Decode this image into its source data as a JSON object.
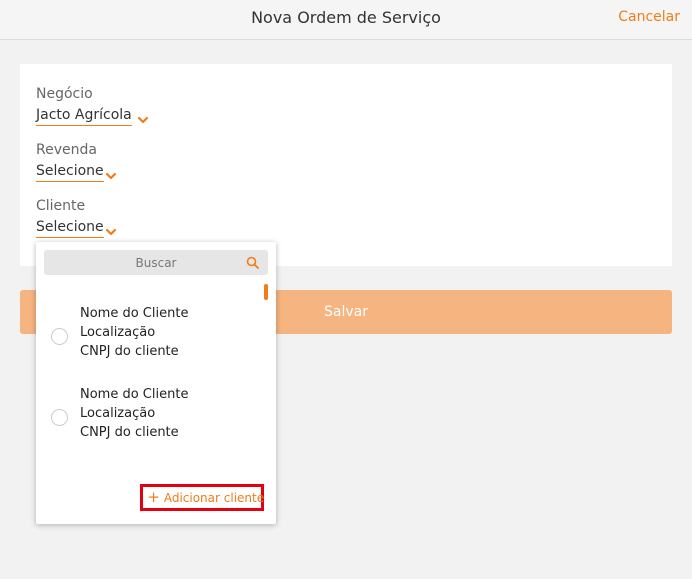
{
  "header": {
    "title": "Nova Ordem de Serviço",
    "cancel_label": "Cancelar"
  },
  "form": {
    "negocio": {
      "label": "Negócio",
      "value": "Jacto Agrícola"
    },
    "revenda": {
      "label": "Revenda",
      "value": "Selecione"
    },
    "cliente": {
      "label": "Cliente",
      "value": "Selecione"
    }
  },
  "save_label": "Salvar",
  "dropdown": {
    "search_placeholder": "Buscar",
    "items": [
      {
        "name": "Nome do Cliente",
        "location": "Localização",
        "cnpj": "CNPJ do cliente"
      },
      {
        "name": "Nome do Cliente",
        "location": "Localização",
        "cnpj": "CNPJ do cliente"
      }
    ],
    "add_label": "Adicionar cliente"
  },
  "colors": {
    "accent": "#f07d1a",
    "save_button": "#f5b480",
    "highlight_border": "#e4000f"
  },
  "icons": [
    "chevron-down-icon",
    "search-icon",
    "plus-icon"
  ]
}
